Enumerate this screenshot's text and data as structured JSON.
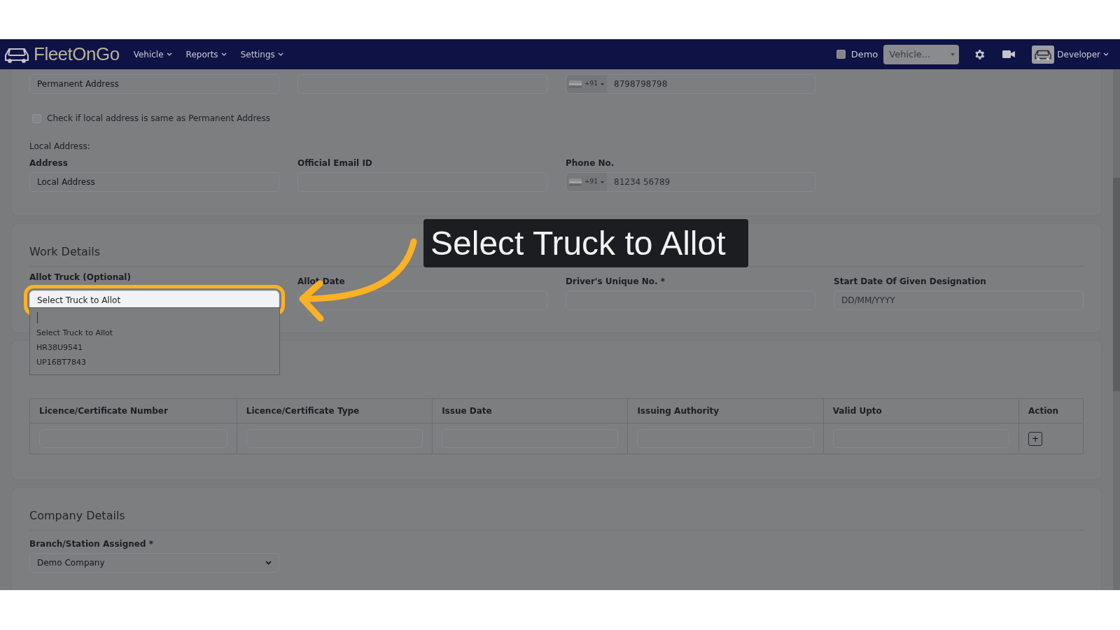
{
  "navbar": {
    "brand": "FleetOnGo",
    "menus": [
      {
        "label": "Vehicle"
      },
      {
        "label": "Reports"
      },
      {
        "label": "Settings"
      }
    ],
    "demo": {
      "label": "Demo",
      "checked": false
    },
    "vehicle_select": {
      "value": "Vehicle..."
    },
    "user": {
      "name": "Developer"
    }
  },
  "address_section": {
    "permanent_fields": [
      {
        "kind": "text",
        "value": "Permanent Address"
      },
      {
        "kind": "text"
      },
      {
        "kind": "phone",
        "code": "+91",
        "value": "8798798798"
      }
    ],
    "same_address": {
      "label": "Check if local address is same as Permanent Address",
      "checked": false
    },
    "local_heading": "Local Address:",
    "local_fields": [
      {
        "kind": "text",
        "label": "Address",
        "value": "Local Address"
      },
      {
        "kind": "text",
        "label": "Official Email ID"
      },
      {
        "kind": "phone",
        "label": "Phone No.",
        "code": "+91",
        "placeholder": "81234 56789"
      }
    ]
  },
  "work_details": {
    "title": "Work Details",
    "fields": [
      {
        "kind": "truck",
        "label": "Allot Truck (Optional)",
        "value": "Select Truck to Allot",
        "highlighted": true
      },
      {
        "kind": "text",
        "label": "Allot Date"
      },
      {
        "kind": "text",
        "label": "Driver's Unique No. *"
      },
      {
        "kind": "text",
        "label": "Start Date Of Given Designation",
        "placeholder": "DD/MM/YYYY"
      }
    ],
    "dropdown": {
      "options": [
        {
          "label": "Select Truck to Allot",
          "selected": false
        },
        {
          "label": "HR38U9541",
          "selected": false
        },
        {
          "label": "UP16BT7843",
          "selected": false
        }
      ]
    }
  },
  "licence_table": {
    "columns": [
      "Licence/Certificate Number",
      "Licence/Certificate Type",
      "Issue Date",
      "Issuing Authority",
      "Valid Upto",
      "Action"
    ],
    "add_button": "+"
  },
  "company_details": {
    "title": "Company Details",
    "label": "Branch/Station Assigned *",
    "value": "Demo Company"
  },
  "callout": {
    "text": "Select Truck to Allot"
  }
}
